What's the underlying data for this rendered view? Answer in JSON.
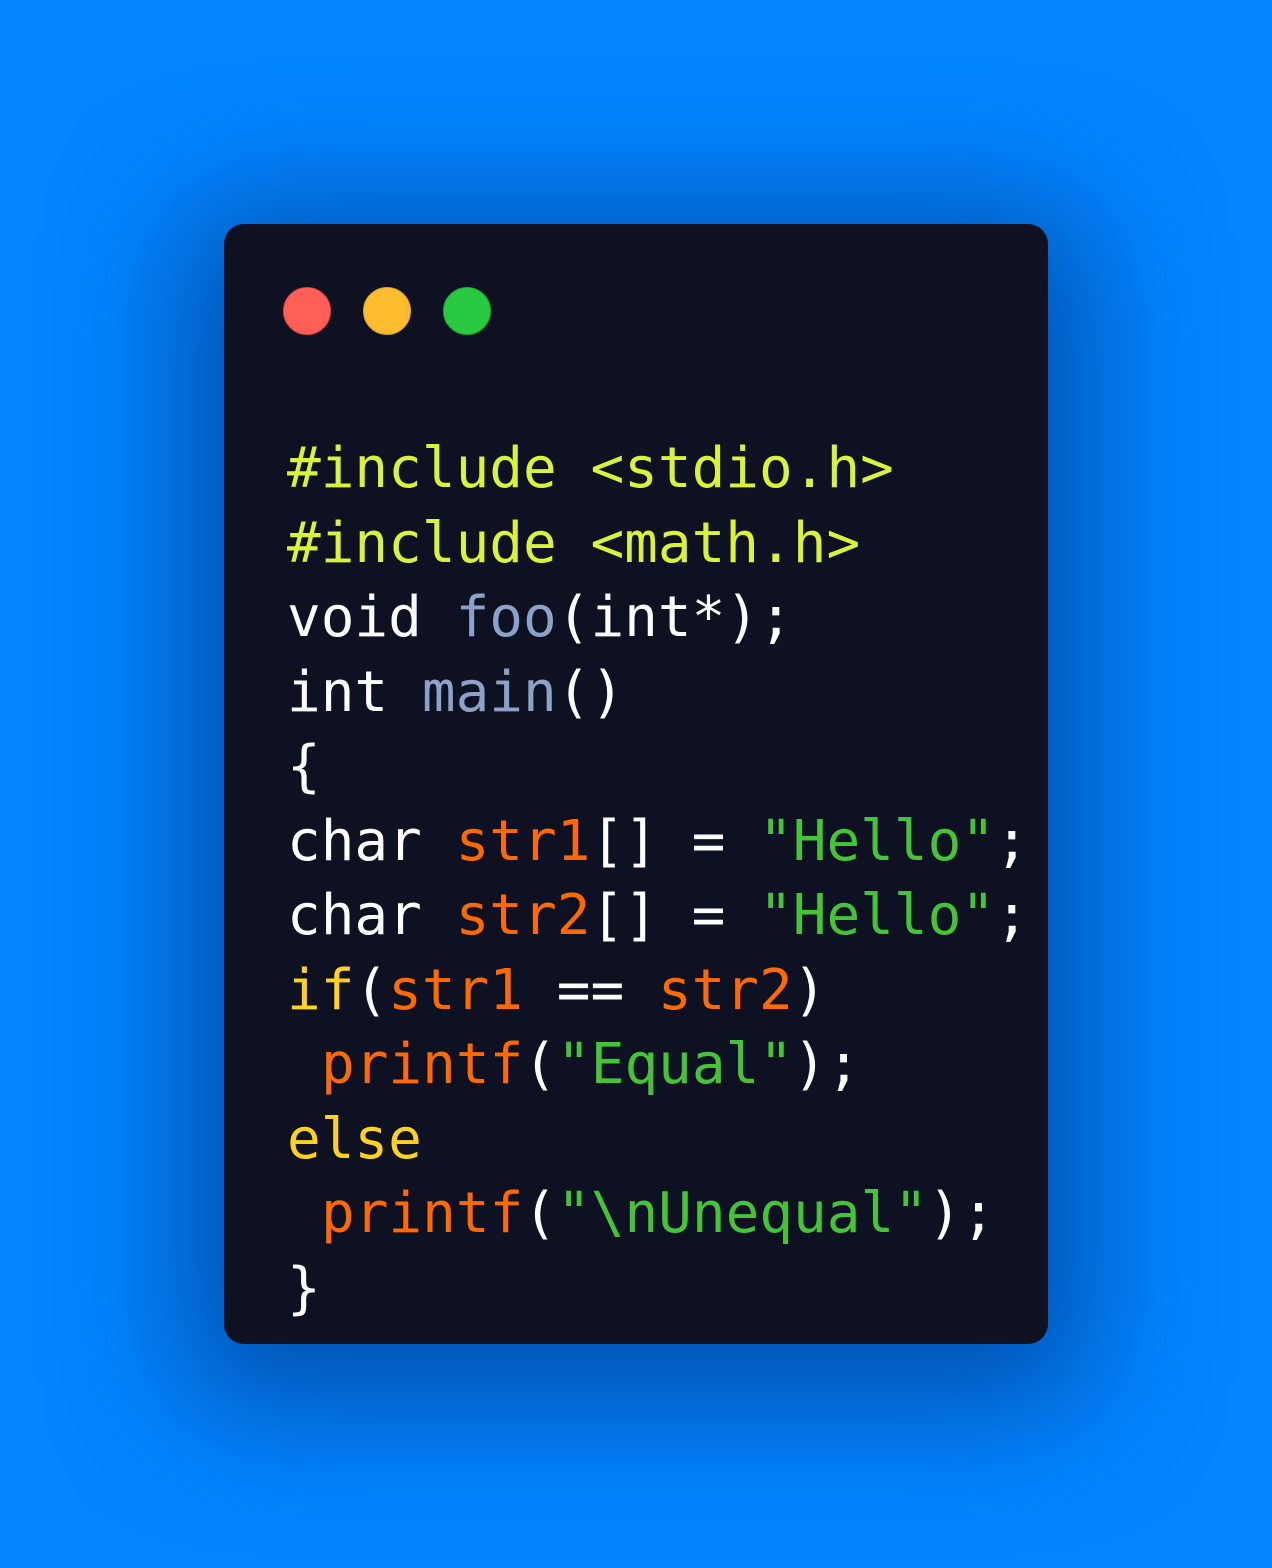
{
  "window": {
    "controls": {
      "close_color": "#ff5f57",
      "minimize_color": "#febc2e",
      "maximize_color": "#28c840"
    }
  },
  "colors": {
    "background": "#0385ff",
    "window": "#0d1121",
    "preprocessor": "#d9f23a",
    "default": "#ffffff",
    "function": "#8da2c8",
    "variable": "#ff6a00",
    "string": "#45c437",
    "keyword_control": "#ffd21f"
  },
  "code": {
    "line1": {
      "directive": "#include",
      "header": "<stdio.h>"
    },
    "line2": {
      "directive": "#include",
      "header": "<math.h>"
    },
    "line3": {
      "type": "void",
      "name": "foo",
      "open": "(",
      "param": "int*",
      "close": ");"
    },
    "line4": {
      "type": "int",
      "name": "main",
      "parens": "()"
    },
    "line5": {
      "brace": "{"
    },
    "line6": {
      "type": "char",
      "var": "str1",
      "mid": "[] = ",
      "str": "\"Hello\"",
      "end": ";"
    },
    "line7": {
      "type": "char",
      "var": "str2",
      "mid": "[] = ",
      "str": "\"Hello\"",
      "end": ";"
    },
    "line8": {
      "kw": "if",
      "open": "(",
      "lhs": "str1",
      "op": " == ",
      "rhs": "str2",
      "close": ")"
    },
    "line9": {
      "fn": "printf",
      "open": "(",
      "str": "\"Equal\"",
      "close": ");"
    },
    "line10": {
      "kw": "else"
    },
    "line11": {
      "fn": "printf",
      "open": "(",
      "str": "\"\\nUnequal\"",
      "close": ");"
    },
    "line12": {
      "brace": "}"
    }
  }
}
